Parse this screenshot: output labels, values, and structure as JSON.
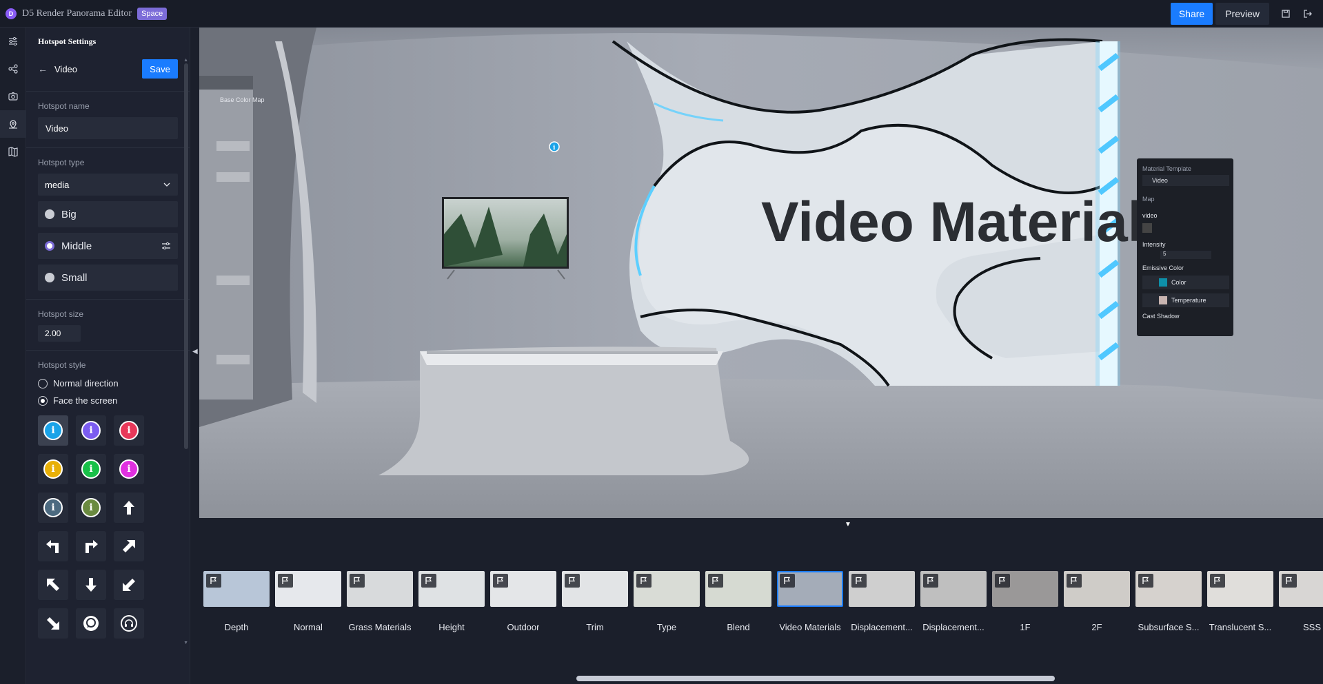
{
  "app": {
    "logo": "D",
    "title": "D5 Render Panorama Editor",
    "badge": "Space"
  },
  "topbar": {
    "share_label": "Share",
    "preview_label": "Preview",
    "icons": [
      "save-icon",
      "exit-icon"
    ]
  },
  "rail": {
    "icons": [
      "sliders-icon",
      "share-nodes-icon",
      "camera-icon",
      "map-pin-icon",
      "map-icon"
    ]
  },
  "panel": {
    "title": "Hotspot Settings",
    "back_label": "Video",
    "save_label": "Save",
    "name_label": "Hotspot name",
    "name_value": "Video",
    "type_label": "Hotspot type",
    "type_value": "media",
    "size_options": [
      "Big",
      "Middle",
      "Small"
    ],
    "size_selected": "Middle",
    "size_label": "Hotspot size",
    "size_value": "2.00",
    "style_label": "Hotspot style",
    "style_options": [
      "Normal direction",
      "Face the screen"
    ],
    "style_selected": "Face the screen",
    "icon_colors": [
      "#1aa3e8",
      "#7b5cf0",
      "#e8385a",
      "#e8b008",
      "#18c048",
      "#e030e0",
      "#4c6a80",
      "#6a8a40"
    ]
  },
  "viewport": {
    "wall_text": "Video Materials",
    "left_panel_label": "Base Color Map",
    "right_panel": {
      "template_label": "Material Template",
      "template_value": "Video",
      "map_label": "Map",
      "video_label": "video",
      "intensity_label": "Intensity",
      "intensity_value": "5",
      "emissive_label": "Emissive Color",
      "color_label": "Color",
      "temperature_label": "Temperature",
      "cast_shadow_label": "Cast Shadow"
    }
  },
  "filmstrip": {
    "selected": "Video Materials",
    "items": [
      {
        "label": "Depth",
        "bg": "#b8c6d8"
      },
      {
        "label": "Normal",
        "bg": "#e6e8ec"
      },
      {
        "label": "Grass Materials",
        "bg": "#d8dadc"
      },
      {
        "label": "Height",
        "bg": "#dfe2e4"
      },
      {
        "label": "Outdoor",
        "bg": "#e4e6e8"
      },
      {
        "label": "Trim",
        "bg": "#e2e4e6"
      },
      {
        "label": "Type",
        "bg": "#d9dcd6"
      },
      {
        "label": "Blend",
        "bg": "#d6dad2"
      },
      {
        "label": "Video Materials",
        "bg": "#a4acb8"
      },
      {
        "label": "Displacement...",
        "bg": "#cfcfcf"
      },
      {
        "label": "Displacement...",
        "bg": "#bfbfbf"
      },
      {
        "label": "1F",
        "bg": "#9a9898"
      },
      {
        "label": "2F",
        "bg": "#cfccc8"
      },
      {
        "label": "Subsurface S...",
        "bg": "#d6d2ce"
      },
      {
        "label": "Translucent S...",
        "bg": "#e0dedb"
      },
      {
        "label": "SSS",
        "bg": "#d8d6d4"
      }
    ]
  }
}
